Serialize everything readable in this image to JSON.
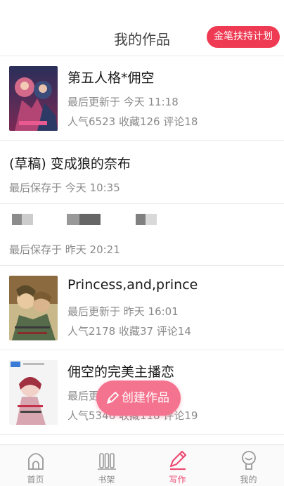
{
  "header": {
    "title": "我的作品",
    "program_button": "金笔扶持计划"
  },
  "works": [
    {
      "kind": "published",
      "title": "第五人格*佣空",
      "updated": "最后更新于 今天 11:18",
      "stats": "人气6523 收藏126 评论18"
    },
    {
      "kind": "draft",
      "title": "(草稿) 变成狼的奈布",
      "saved": "最后保存于 今天 10:35"
    },
    {
      "kind": "draft-obscured",
      "saved": "最后保存于 昨天 20:21"
    },
    {
      "kind": "published",
      "title": "Princess,and,prince",
      "updated": "最后更新于 昨天 16:01",
      "stats": "人气2178 收藏37 评论14"
    },
    {
      "kind": "published",
      "title": "佣空的完美主播恋",
      "updated": "最后更",
      "stats": "人气5346 收藏118 评论19"
    }
  ],
  "fab": {
    "label": "创建作品"
  },
  "tabs": [
    {
      "label": "首页",
      "icon": "home-icon"
    },
    {
      "label": "书架",
      "icon": "bookshelf-icon"
    },
    {
      "label": "写作",
      "icon": "pen-icon",
      "active": true
    },
    {
      "label": "我的",
      "icon": "profile-icon"
    }
  ],
  "colors": {
    "accent": "#ee3a52",
    "fab": "#f4748f",
    "active_tab": "#ee4c73",
    "meta_text": "#8a8a8a"
  }
}
